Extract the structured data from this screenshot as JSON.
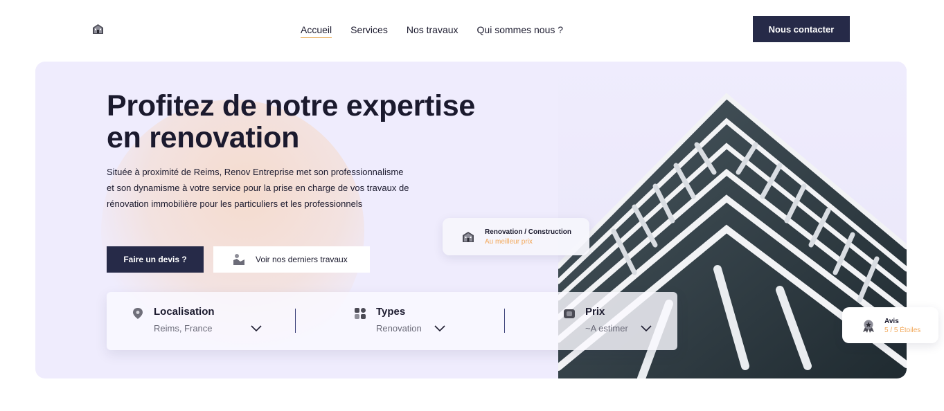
{
  "brand": {
    "logo_icon": "house-icon"
  },
  "nav": {
    "items": [
      {
        "label": "Accueil",
        "active": true
      },
      {
        "label": "Services",
        "active": false
      },
      {
        "label": "Nos travaux",
        "active": false
      },
      {
        "label": "Qui sommes nous ?",
        "active": false
      }
    ],
    "contact_label": "Nous contacter"
  },
  "hero": {
    "title_line1": "Profitez de notre expertise",
    "title_line2": "en renovation",
    "description": "Située à proximité de Reims, Renov Entreprise met son professionnalisme et son dynamisme à votre service pour la prise en charge de vos travaux de rénovation immobilière pour les particuliers et les professionnels",
    "primary_button": "Faire un devis ?",
    "secondary_button": "Voir nos derniers travaux"
  },
  "search": {
    "location": {
      "label": "Localisation",
      "value": "Reims, France",
      "icon": "map-pin-icon"
    },
    "types": {
      "label": "Types",
      "value": "Renovation",
      "icon": "grid-icon"
    },
    "price": {
      "label": "Prix",
      "value": "~A estimer",
      "icon": "wallet-icon"
    }
  },
  "cards": {
    "construction": {
      "title": "Renovation / Construction",
      "subtitle": "Au meilleur prix",
      "icon": "house-icon"
    },
    "reviews": {
      "title": "Avis",
      "subtitle": "5 / 5 Étoiles",
      "icon": "award-icon"
    }
  },
  "colors": {
    "navy": "#262a48",
    "hero_bg": "#efecfd",
    "accent_orange": "#f2a85a",
    "text": "#1b1a2e"
  }
}
